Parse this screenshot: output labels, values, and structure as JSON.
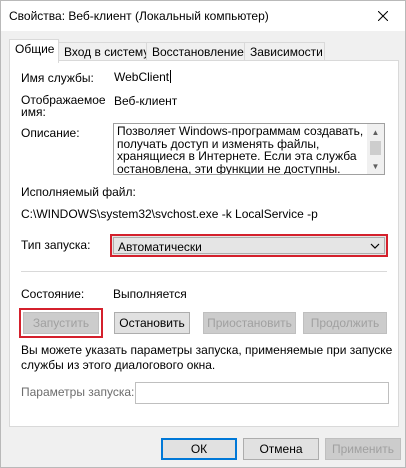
{
  "window": {
    "title": "Свойства: Веб-клиент (Локальный компьютер)",
    "close_icon": "close-icon"
  },
  "tabs": [
    {
      "label": "Общие",
      "active": true
    },
    {
      "label": "Вход в систему",
      "active": false
    },
    {
      "label": "Восстановление",
      "active": false
    },
    {
      "label": "Зависимости",
      "active": false
    }
  ],
  "general": {
    "service_name_label": "Имя службы:",
    "service_name_value": "WebClient",
    "display_name_label_1": "Отображаемое",
    "display_name_label_2": "имя:",
    "display_name_value": "Веб-клиент",
    "description_label": "Описание:",
    "description_text": "Позволяет Windows-программам создавать, получать доступ и изменять файлы, хранящиеся в Интернете. Если эта служба остановлена, эти функции не доступны. Если",
    "executable_label": "Исполняемый файл:",
    "executable_path": "C:\\WINDOWS\\system32\\svchost.exe -k LocalService -p",
    "startup_type_label": "Тип запуска:",
    "startup_type_value": "Автоматически",
    "status_label": "Состояние:",
    "status_value": "Выполняется",
    "buttons": {
      "start": "Запустить",
      "stop": "Остановить",
      "pause": "Приостановить",
      "resume": "Продолжить"
    },
    "hint_line_1": "Вы можете указать параметры запуска, применяемые при запуске",
    "hint_line_2": "службы из этого диалогового окна.",
    "params_label": "Параметры запуска:",
    "params_value": ""
  },
  "footer": {
    "ok": "ОК",
    "cancel": "Отмена",
    "apply": "Применить"
  },
  "colors": {
    "highlight": "#d4202c",
    "primary_border": "#0078d7"
  }
}
